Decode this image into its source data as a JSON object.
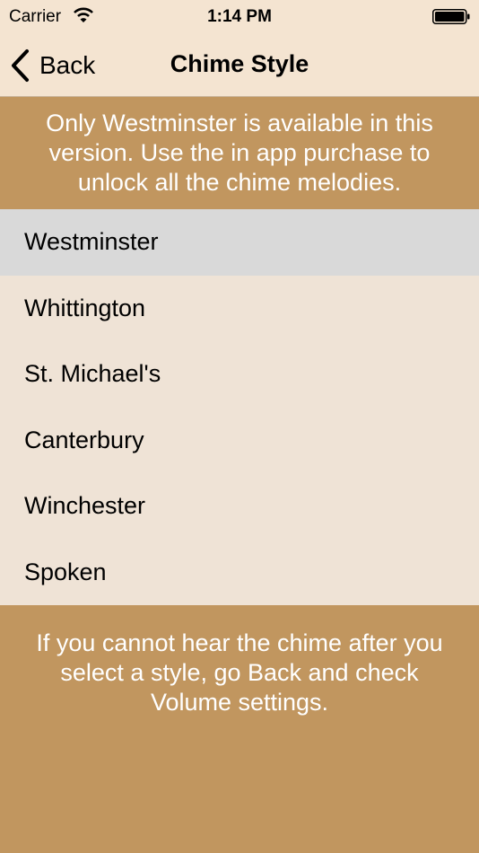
{
  "status_bar": {
    "carrier": "Carrier",
    "time": "1:14 PM",
    "wifi_icon": "wifi-icon",
    "battery_icon": "battery-icon"
  },
  "nav": {
    "back_label": "Back",
    "back_icon": "chevron-left-icon",
    "title": "Chime Style"
  },
  "notice_top": "Only Westminster is available in this version. Use the in app purchase to unlock all the chime melodies.",
  "chime_styles": [
    {
      "label": "Westminster",
      "selected": true
    },
    {
      "label": "Whittington",
      "selected": false
    },
    {
      "label": "St. Michael's",
      "selected": false
    },
    {
      "label": "Canterbury",
      "selected": false
    },
    {
      "label": "Winchester",
      "selected": false
    },
    {
      "label": "Spoken",
      "selected": false
    }
  ],
  "notice_bottom": "If you cannot hear the chime after you select a style, go Back and check Volume settings.",
  "colors": {
    "header_bg": "#f4e4d1",
    "banner_bg": "#c1965f",
    "list_bg": "#efe3d6",
    "selected_bg": "#d9d9d9"
  }
}
